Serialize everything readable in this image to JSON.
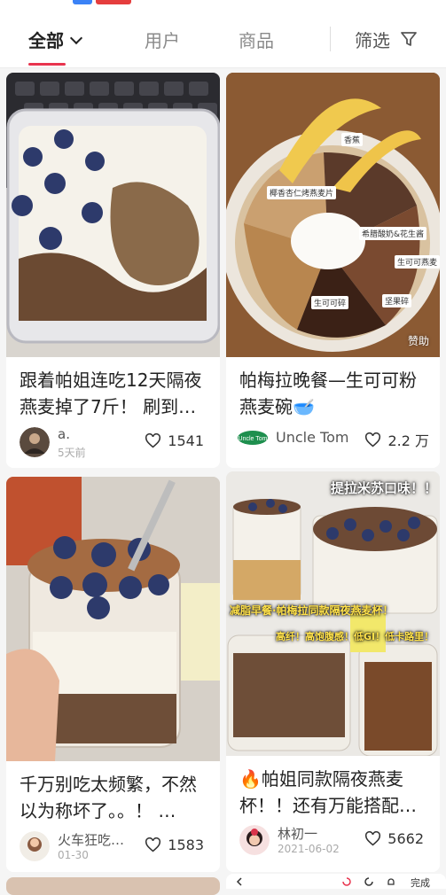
{
  "tabs": [
    {
      "label": "全部",
      "active": true
    },
    {
      "label": "用户"
    },
    {
      "label": "商品"
    }
  ],
  "filter_label": "筛选",
  "colors": {
    "accent": "#e8344e"
  },
  "cards": [
    {
      "title": "跟着帕姐连吃12天隔夜燕麦掉了7斤！ 刷到…",
      "author": "a.",
      "meta": "5天前",
      "likes": "1541"
    },
    {
      "title": "帕梅拉晚餐—生可可粉燕麦碗🥣",
      "author": "Uncle Tom",
      "likes": "2.2 万",
      "badge": "赞助",
      "brand_logo_text": "Uncle Tom",
      "image_labels": [
        "香蕉",
        "椰香杏仁烤燕麦片",
        "希腊酸奶&花生酱",
        "生可可燕麦",
        "生可可碎",
        "坚果碎"
      ]
    },
    {
      "title": "千万别吃太频繁，不然以为称坏了。。！ …",
      "author": "火车狂吃…",
      "meta": "01-30",
      "likes": "1583"
    },
    {
      "title": "🔥帕姐同款隔夜燕麦杯！！还有万能搭配…",
      "author": "林初一",
      "meta": "2021-06-02",
      "likes": "5662",
      "image_texts": [
        "提拉米苏口味！！",
        "减脂早餐·帕梅拉同款隔夜燕麦杯！",
        "高纤！高饱腹感！低GI！低卡路里！"
      ]
    }
  ],
  "bottom_bar": {
    "done_label": "完成"
  }
}
